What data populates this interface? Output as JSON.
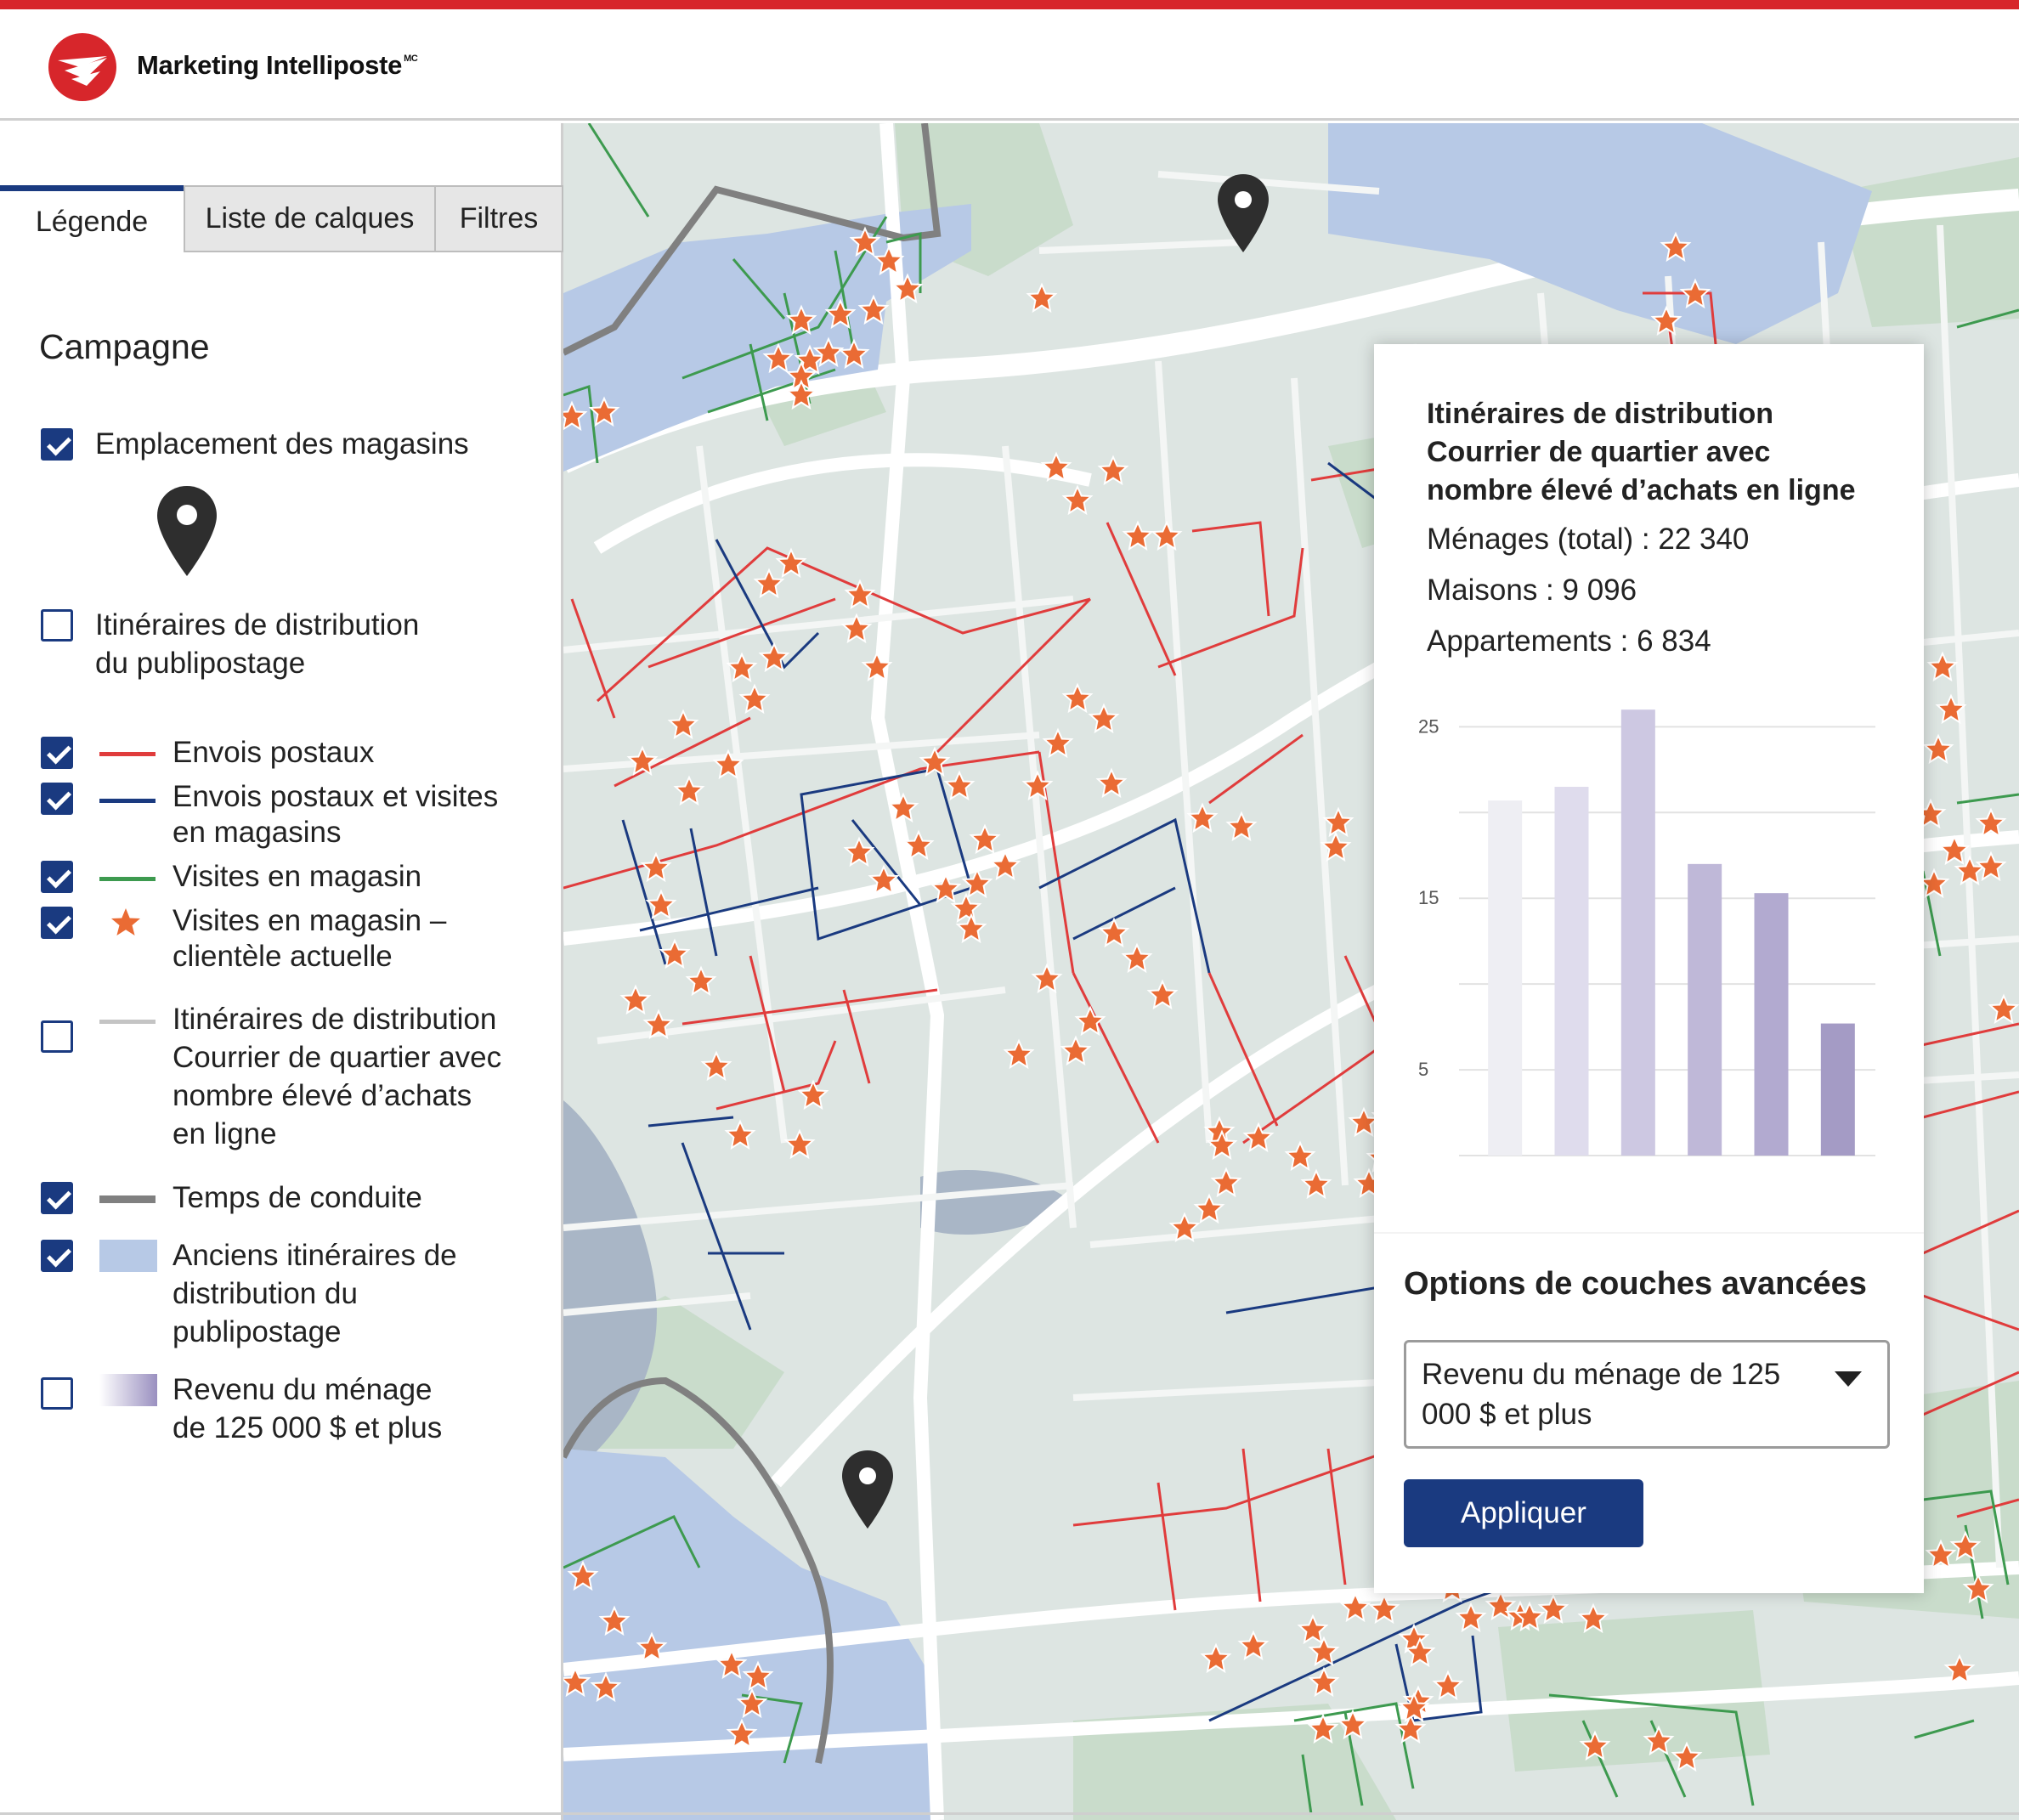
{
  "header": {
    "brand": "Marketing Intelliposte",
    "brand_mark": "MC"
  },
  "sidebar": {
    "tabs": [
      {
        "label": "Légende",
        "active": true
      },
      {
        "label": "Liste de calques",
        "active": false
      },
      {
        "label": "Filtres",
        "active": false
      }
    ],
    "section_title": "Campagne",
    "legend": [
      {
        "label": "Emplacement des magasins",
        "checked": true,
        "icon": "map-pin-icon"
      },
      {
        "label_lines": [
          "Itinéraires de distribution",
          "du publipostage"
        ],
        "checked": false
      },
      {
        "label": "Envois postaux",
        "checked": true,
        "color": "#e03c3c"
      },
      {
        "label_lines": [
          "Envois postaux et visites",
          "en magasins"
        ],
        "checked": true,
        "color": "#1a3a80"
      },
      {
        "label": "Visites en magasin",
        "checked": true,
        "color": "#3d9a4f"
      },
      {
        "label_lines": [
          "Visites en magasin –",
          "clientèle actuelle"
        ],
        "checked": true,
        "color": "#ea6b34",
        "icon": "star-icon"
      },
      {
        "label_lines": [
          "Itinéraires de distribution",
          "Courrier de quartier avec",
          "nombre élevé d’achats",
          "en ligne"
        ],
        "checked": false,
        "color": "#c4c4c4"
      },
      {
        "label": "Temps de conduite",
        "checked": true,
        "color": "#808080"
      },
      {
        "label_lines": [
          "Anciens itinéraires de",
          "distribution du",
          "publipostage"
        ],
        "checked": true,
        "color": "#b7c9e6"
      },
      {
        "label_lines": [
          "Revenu du ménage",
          "de 125 000 $ et plus"
        ],
        "checked": false,
        "color": "#9a90c0"
      }
    ]
  },
  "popup": {
    "title_lines": [
      "Itinéraires de distribution",
      "Courrier de quartier avec",
      "nombre élevé d’achats en ligne"
    ],
    "stats": [
      "Ménages (total) : 22 340",
      "Maisons : 9 096",
      "Appartements : 6 834"
    ],
    "options_title": "Options de couches avancées",
    "select_value": "Revenu du ménage de 125 000 $ et plus",
    "apply_label": "Appliquer"
  },
  "chart_data": {
    "type": "bar",
    "categories": [
      "",
      "",
      "",
      "",
      "",
      ""
    ],
    "values": [
      20.7,
      21.5,
      26,
      17,
      15.3,
      7.7
    ],
    "bar_colors": [
      "#eeeef3",
      "#dfdced",
      "#cdc8e2",
      "#bfb8d8",
      "#b2aad0",
      "#a49bc5"
    ],
    "yticks": [
      5,
      15,
      25
    ],
    "ylim": [
      0,
      27
    ],
    "grid": true,
    "title": "",
    "xlabel": "",
    "ylabel": ""
  },
  "map": {
    "colors": {
      "land": "#dde5e2",
      "park": "#c9dccb",
      "water": "#a9b6c6",
      "old_routes": "#b7c9e6",
      "postal": "#e03c3c",
      "postal_store": "#1a3a80",
      "store_visits": "#3d9a4f",
      "star": "#ea6b34",
      "drive_time": "#808080",
      "pin": "#2e2e2e"
    }
  }
}
